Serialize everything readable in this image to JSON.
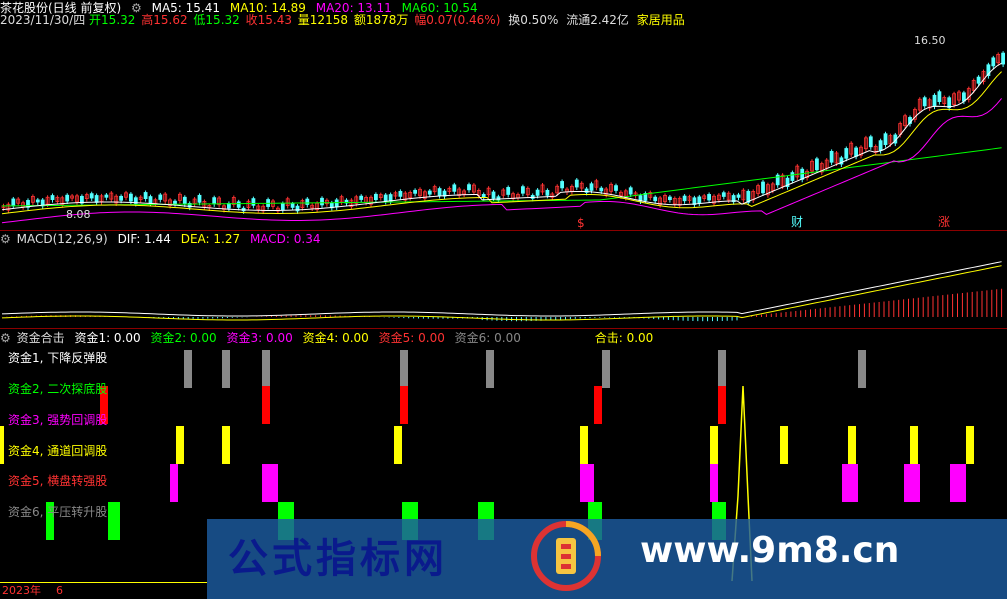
{
  "header": {
    "title": "茶花股份(日线 前复权)",
    "ma5": "MA5: 15.41",
    "ma10": "MA10: 14.89",
    "ma20": "MA20: 13.11",
    "ma60": "MA60: 10.54"
  },
  "quote": {
    "date": "2023/11/30/四",
    "open": "开15.32",
    "high": "高15.62",
    "low": "低15.32",
    "close": "收15.43",
    "volume": "量12158",
    "amount": "额1878万",
    "change": "幅0.07(0.46%)",
    "turnover": "换0.50%",
    "float": "流通2.42亿",
    "industry": "家居用品"
  },
  "price_labels": {
    "high": "16.50",
    "low": "8.08"
  },
  "markers": {
    "m1": "$",
    "m2": "财",
    "m3": "涨"
  },
  "macd": {
    "title": "MACD(12,26,9)",
    "dif": "DIF: 1.44",
    "dea": "DEA: 1.27",
    "macd": "MACD: 0.34"
  },
  "fund": {
    "title": "资金合击",
    "f1": "资金1: 0.00",
    "f2": "资金2: 0.00",
    "f3": "资金3: 0.00",
    "f4": "资金4: 0.00",
    "f5": "资金5: 0.00",
    "f6": "资金6: 0.00",
    "hit": "合击: 0.00",
    "labels": [
      "资金1, 下降反弹股",
      "资金2, 二次探底股",
      "资金3, 强势回调股",
      "资金4, 通道回调股",
      "资金5, 横盘转强股",
      "资金6, 平压转升股"
    ]
  },
  "axis": {
    "year": "2023年",
    "month": "6"
  },
  "watermark": {
    "cn": "公式指标网",
    "url": "www.9m8.cn"
  },
  "colors": {
    "up": "#ff3232",
    "down": "#54ffff",
    "ma5": "#ffffff",
    "ma10": "#ffff00",
    "ma20": "#ff00ff",
    "ma60": "#00ff00"
  }
}
